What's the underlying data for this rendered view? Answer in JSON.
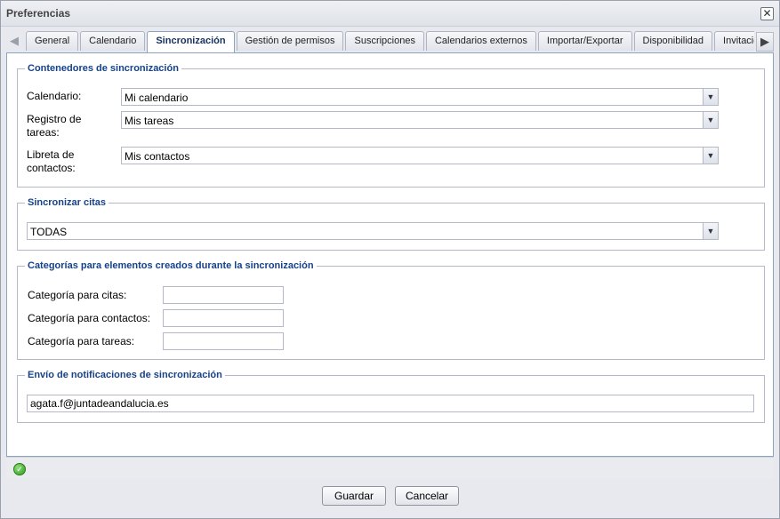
{
  "window": {
    "title": "Preferencias"
  },
  "tabs": [
    {
      "label": "General"
    },
    {
      "label": "Calendario"
    },
    {
      "label": "Sincronización",
      "active": true
    },
    {
      "label": "Gestión de permisos"
    },
    {
      "label": "Suscripciones"
    },
    {
      "label": "Calendarios externos"
    },
    {
      "label": "Importar/Exportar"
    },
    {
      "label": "Disponibilidad"
    },
    {
      "label": "Invitaciones"
    }
  ],
  "sync_containers": {
    "legend": "Contenedores de sincronización",
    "calendar_label": "Calendario:",
    "calendar_value": "Mi calendario",
    "tasks_label_1": "Registro de",
    "tasks_label_2": "tareas:",
    "tasks_value": "Mis tareas",
    "contacts_label_1": "Libreta de",
    "contacts_label_2": "contactos:",
    "contacts_value": "Mis contactos"
  },
  "sync_appointments": {
    "legend": "Sincronizar citas",
    "value": "TODAS"
  },
  "categories": {
    "legend": "Categorías para elementos creados durante la sincronización",
    "appointments_label": "Categoría para citas:",
    "appointments_value": "",
    "contacts_label": "Categoría para contactos:",
    "contacts_value": "",
    "tasks_label": "Categoría para tareas:",
    "tasks_value": ""
  },
  "notifications": {
    "legend": "Envío de notificaciones de sincronización",
    "email": "agata.f@juntadeandalucia.es"
  },
  "buttons": {
    "save": "Guardar",
    "cancel": "Cancelar"
  },
  "colors": {
    "legend": "#15428b",
    "field_border": "#b5b8c8",
    "status_ok": "#2f9a1e"
  }
}
